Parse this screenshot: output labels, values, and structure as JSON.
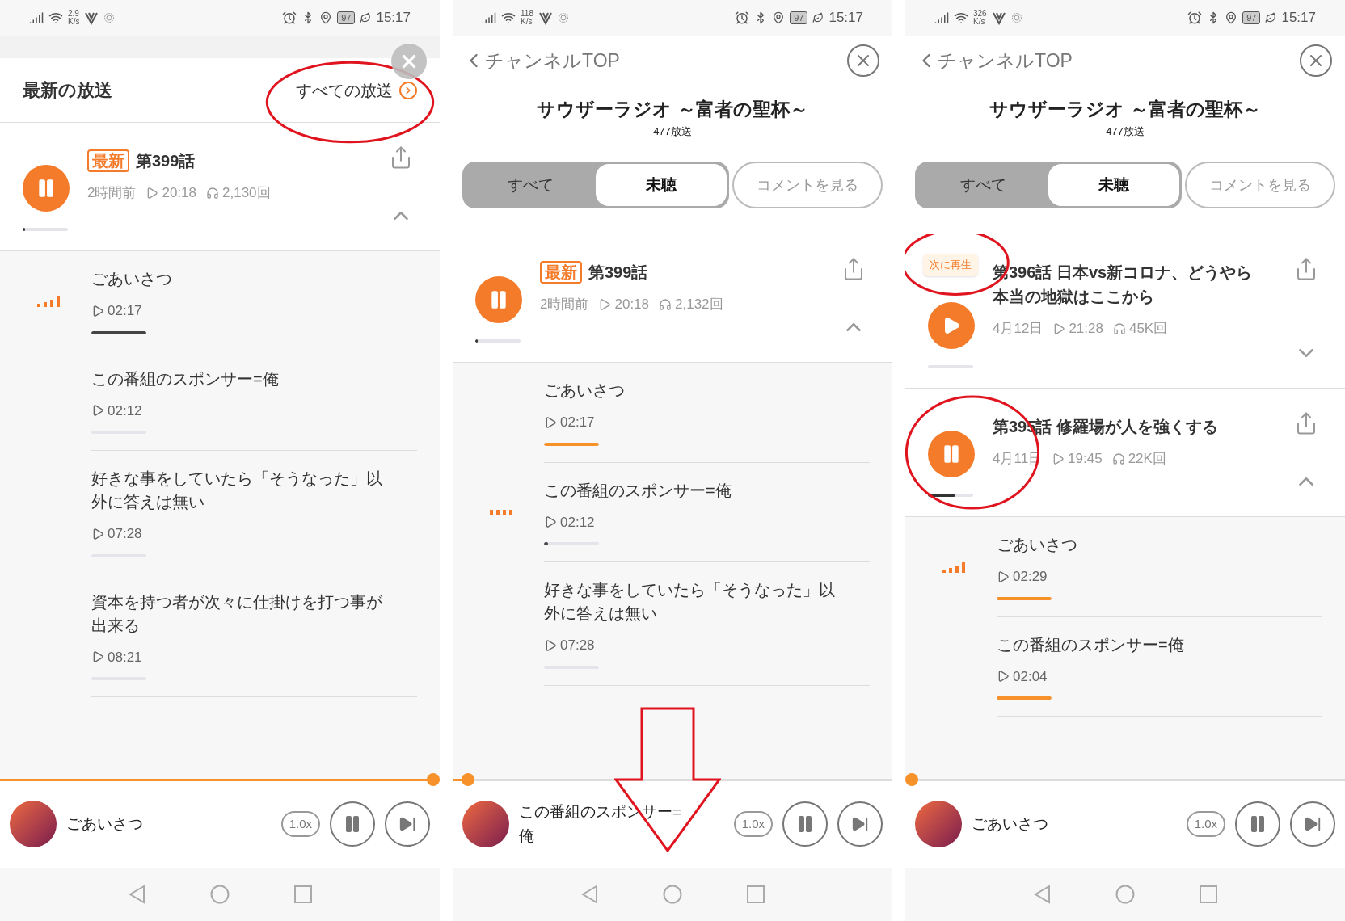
{
  "panels": [
    {
      "kind": "sheet",
      "status": {
        "speed": "2.9",
        "speed_unit": "K/s",
        "battery": "97",
        "time": "15:17"
      },
      "header": {
        "title": "最新の放送",
        "link": "すべての放送",
        "circled": true
      },
      "episodes": [
        {
          "badge": "最新",
          "title": "第399話",
          "date": "2時間前",
          "duration": "20:18",
          "plays": "2,130回",
          "playing": true,
          "expanded": true,
          "level": 0.05,
          "chapters": [
            {
              "kind": "equalizer",
              "title": "ごあいさつ",
              "duration": "02:17",
              "played": false,
              "level": 1
            },
            {
              "kind": "plain",
              "title": "この番組のスポンサー=俺",
              "duration": "02:12",
              "played": false,
              "level": 0
            },
            {
              "kind": "plain",
              "title": "好きな事をしていたら「そうなった」以外に答えは無い",
              "duration": "07:28",
              "played": false,
              "level": 0
            },
            {
              "kind": "plain",
              "title": "資本を持つ者が次々に仕掛けを打つ事が出来る",
              "duration": "08:21",
              "played": false,
              "level": 0
            }
          ]
        }
      ],
      "player": {
        "title": "ごあいさつ",
        "speed": "1.0x",
        "level": 1,
        "playing": true
      }
    },
    {
      "kind": "channel",
      "status": {
        "speed": "118",
        "speed_unit": "K/s",
        "battery": "97",
        "time": "15:17"
      },
      "header": {
        "back": "チャンネルTOP",
        "title": "サウザーラジオ ～富者の聖杯～",
        "count": "477放送",
        "tabs": [
          {
            "label": "すべて",
            "selected": false
          },
          {
            "label": "未聴",
            "selected": true
          }
        ],
        "comments": "コメントを見る"
      },
      "episodes": [
        {
          "badge": "最新",
          "title": "第399話",
          "date": "2時間前",
          "duration": "20:18",
          "plays": "2,132回",
          "playing": true,
          "expanded": true,
          "level": 0.05,
          "chapters": [
            {
              "kind": "plain",
              "title": "ごあいさつ",
              "duration": "02:17",
              "played": true,
              "level": 1
            },
            {
              "kind": "loading",
              "title": "この番組のスポンサー=俺",
              "duration": "02:12",
              "played": false,
              "level": 0.08
            },
            {
              "kind": "plain",
              "title": "好きな事をしていたら「そうなった」以外に答えは無い",
              "duration": "07:28",
              "played": false,
              "level": 0
            }
          ]
        }
      ],
      "player": {
        "title": "この番組のスポンサー=俺",
        "speed": "1.0x",
        "level": 0.02,
        "playing": true
      },
      "arrow": true
    },
    {
      "kind": "channel",
      "status": {
        "speed": "326",
        "speed_unit": "K/s",
        "battery": "97",
        "time": "15:17"
      },
      "header": {
        "back": "チャンネルTOP",
        "title": "サウザーラジオ ～富者の聖杯～",
        "count": "477放送",
        "tabs": [
          {
            "label": "すべて",
            "selected": false
          },
          {
            "label": "未聴",
            "selected": true
          }
        ],
        "comments": "コメントを見る"
      },
      "episodes": [
        {
          "next_label": "次に再生",
          "title": "第396話 日本vs新コロナ、どうやら本当の地獄はここから",
          "date": "4月12日",
          "duration": "21:28",
          "plays": "45K回",
          "playing": false,
          "expanded": false,
          "level": 0
        },
        {
          "title": "第395話 修羅場が人を強くする",
          "date": "4月11日",
          "duration": "19:45",
          "plays": "22K回",
          "playing": true,
          "expanded": true,
          "level": 0.6,
          "circled": true,
          "chapters": [
            {
              "kind": "equalizer",
              "title": "ごあいさつ",
              "duration": "02:29",
              "played": true,
              "level": 1
            },
            {
              "kind": "plain",
              "title": "この番組のスポンサー=俺",
              "duration": "02:04",
              "played": true,
              "level": 1
            }
          ]
        }
      ],
      "player": {
        "title": "ごあいさつ",
        "speed": "1.0x",
        "level": 0,
        "playing": true
      }
    }
  ]
}
